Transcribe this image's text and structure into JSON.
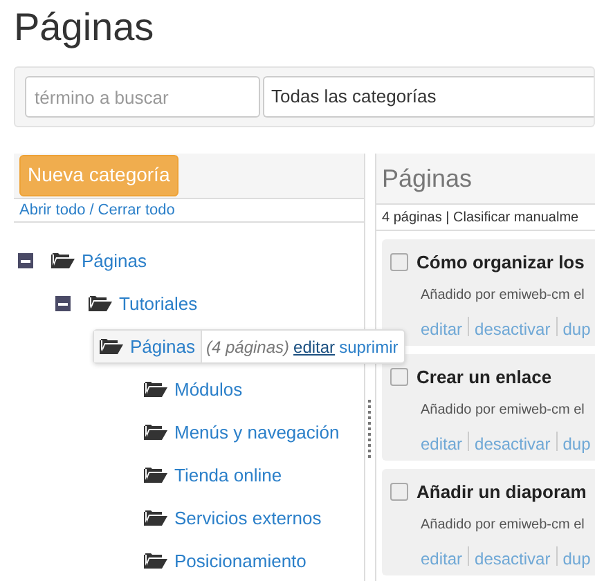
{
  "page_title": "Páginas",
  "filter": {
    "search_placeholder": "término a buscar",
    "category": "Todas las categorías"
  },
  "sidebar": {
    "new_button": "Nueva categoría",
    "expand_all": "Abrir todo",
    "separator": "/",
    "collapse_all": "Cerrar todo",
    "tree": [
      {
        "label": "Páginas",
        "expanded": true,
        "selected": false,
        "children": [
          {
            "label": "Tutoriales",
            "expanded": true,
            "selected": false,
            "children": [
              {
                "label": "Páginas",
                "selected": true,
                "count": "(4 páginas)",
                "actions": [
                  "editar",
                  "suprimir"
                ]
              },
              {
                "label": "Módulos",
                "selected": false
              },
              {
                "label": "Menús y navegación",
                "selected": false
              },
              {
                "label": "Tienda online",
                "selected": false
              },
              {
                "label": "Servicios externos",
                "selected": false
              },
              {
                "label": "Posicionamiento",
                "selected": false
              }
            ]
          }
        ]
      }
    ]
  },
  "content": {
    "title": "Páginas",
    "summary": "4 páginas | Clasificar manualme",
    "items": [
      {
        "title": "Cómo organizar los",
        "checked": false,
        "meta": "Añadido por emiweb-cm el",
        "actions": [
          "editar",
          "desactivar",
          "dup"
        ]
      },
      {
        "title": "Crear un enlace",
        "checked": false,
        "meta": "Añadido por emiweb-cm el",
        "actions": [
          "editar",
          "desactivar",
          "dup"
        ]
      },
      {
        "title": "Añadir un diaporam",
        "checked": false,
        "meta": "Añadido por emiweb-cm el",
        "actions": [
          "editar",
          "desactivar",
          "dup"
        ]
      }
    ]
  }
}
